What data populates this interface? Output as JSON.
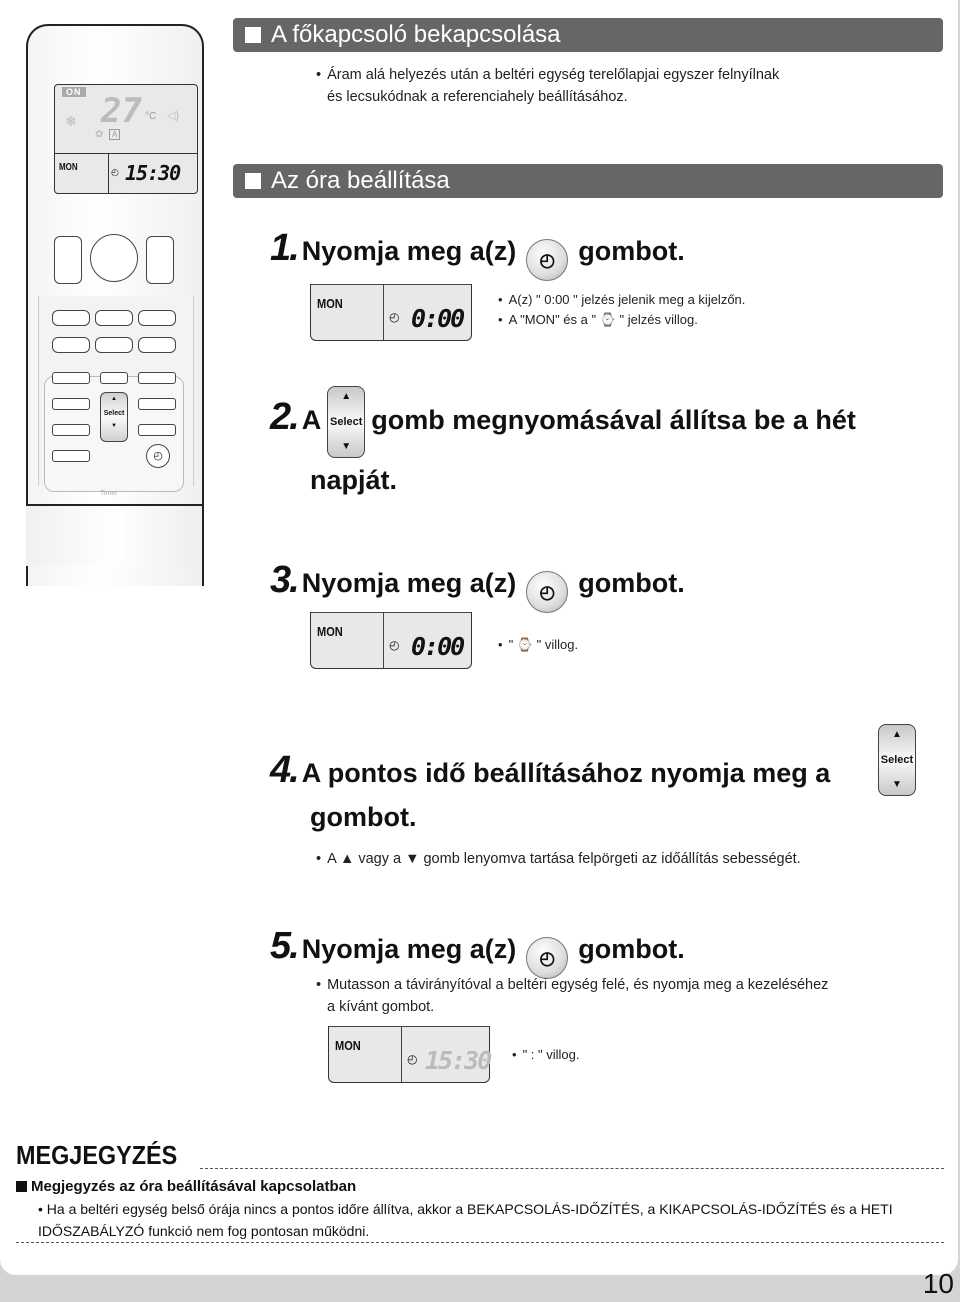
{
  "remote": {
    "lcd_on": "ON",
    "lcd_temp": "27",
    "lcd_unit": "°C",
    "lcd_day": "MON",
    "lcd_time": "15:30",
    "select_label": "Select",
    "timer_label": "Timer"
  },
  "section1": {
    "title": "A főkapcsoló bekapcsolása",
    "bullet": "Áram alá helyezés után a beltéri egység terelőlapjai egyszer felnyílnak",
    "bullet_cont": "és lecsukódnak a referenciahely beállításához."
  },
  "section2": {
    "title": "Az óra beállítása"
  },
  "steps": [
    {
      "num": "1.",
      "pre": "Nyomja meg a(z)",
      "post": "gombot.",
      "lcd_day": "MON",
      "lcd_time": "0:00",
      "bullets": [
        "A(z) \" 0:00 \" jelzés jelenik meg a kijelzőn.",
        "A \"MON\" és a \" ⌚ \" jelzés villog."
      ]
    },
    {
      "num": "2.",
      "pre": "A",
      "post": "gomb megnyomásával állítsa be a hét",
      "line2": "napját."
    },
    {
      "num": "3.",
      "pre": "Nyomja meg a(z)",
      "post": "gombot.",
      "lcd_day": "MON",
      "lcd_time": "0:00",
      "bullets": [
        "\" ⌚ \" villog."
      ]
    },
    {
      "num": "4.",
      "pre": "A pontos idő beállításához nyomja meg a",
      "line2": "gombot.",
      "bullets": [
        "A ▲ vagy a ▼ gomb lenyomva tartása felpörgeti az időállítás sebességét."
      ]
    },
    {
      "num": "5.",
      "pre": "Nyomja meg a(z)",
      "post": "gombot.",
      "lcd_day": "MON",
      "lcd_time": "15:30",
      "bullets": [
        "Mutasson a távirányítóval a beltéri egység felé, és nyomja meg a kezeléséhez",
        "a kívánt gombot.",
        "\" : \" villog."
      ]
    }
  ],
  "select_button": {
    "up": "▲",
    "label": "Select",
    "down": "▼"
  },
  "clock_glyph": "◴",
  "note": {
    "title": "MEGJEGYZÉS",
    "subtitle": "Megjegyzés az óra beállításával kapcsolatban",
    "body": "Ha a beltéri egység belső órája nincs a pontos időre állítva, akkor a BEKAPCSOLÁS-IDŐZÍTÉS, a KIKAPCSOLÁS-IDŐZÍTÉS és a HETI IDŐSZABÁLYZÓ funkció nem fog pontosan működni."
  },
  "page_number": "10"
}
